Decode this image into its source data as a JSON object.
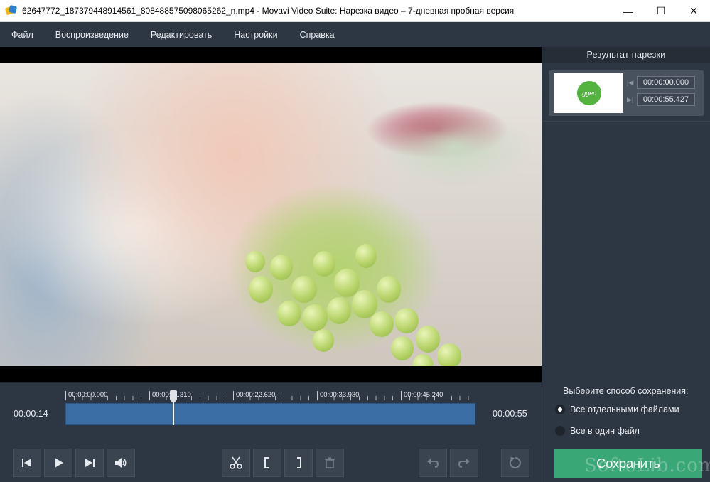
{
  "window": {
    "title": "62647772_187379448914561_8084885750980652​62_n.mp4 - Movavi Video Suite: Нарезка видео – 7-дневная пробная версия",
    "minimize": "—",
    "maximize": "☐",
    "close": "✕"
  },
  "menu": [
    "Файл",
    "Воспроизведение",
    "Редактировать",
    "Настройки",
    "Справка"
  ],
  "panel": {
    "title": "Результат нарезки",
    "clip": {
      "thumb_text": "ggec",
      "start": "00:00:00.000",
      "end": "00:00:55.427"
    },
    "save_caption": "Выберите способ сохранения:",
    "options": [
      {
        "label": "Все отдельными файлами",
        "selected": true
      },
      {
        "label": "Все в один файл",
        "selected": false
      }
    ],
    "save_label": "Сохранить"
  },
  "timeline": {
    "current": "00:00:14",
    "total": "00:00:55",
    "ticks": [
      "00:00:00.000",
      "00:00:11.310",
      "00:00:22.620",
      "00:00:33.930",
      "00:00:45.240"
    ],
    "playhead_position_fraction": 0.263
  },
  "watermark": "SoftoLib.com",
  "colors": {
    "accent_save": "#3aa776",
    "track": "#3a6ea5",
    "panel_bg": "#2d3743"
  }
}
